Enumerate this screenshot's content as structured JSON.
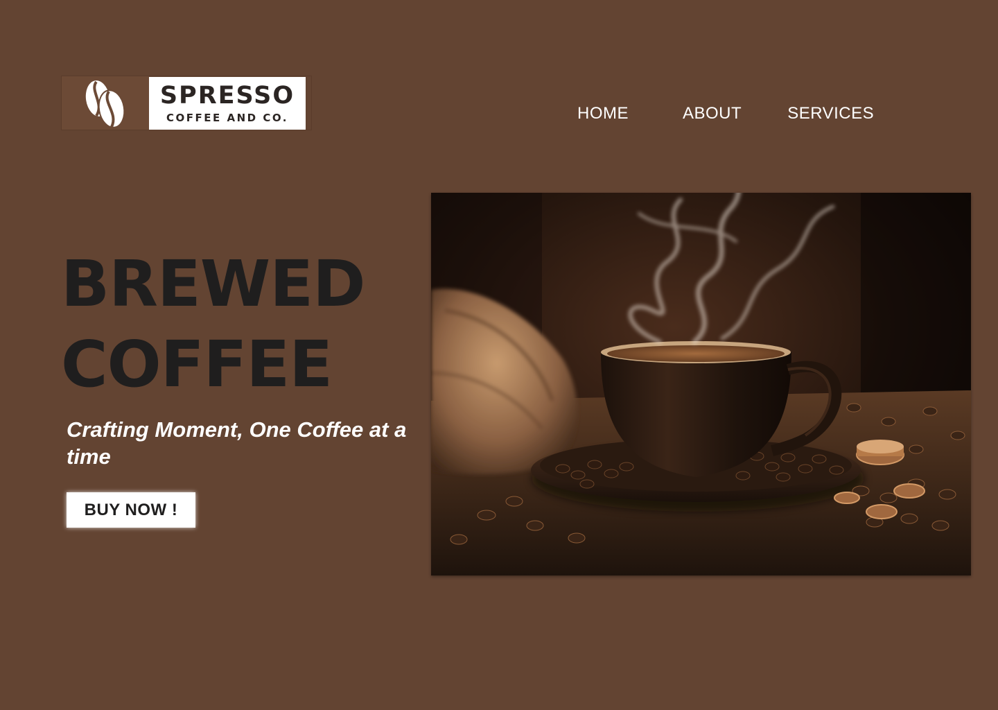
{
  "brand": {
    "name": "SPRESSO",
    "tagline": "COFFEE AND CO.",
    "icon": "coffee-bean-icon"
  },
  "nav": {
    "items": [
      {
        "label": "HOME"
      },
      {
        "label": "ABOUT"
      },
      {
        "label": "SERVICES"
      }
    ]
  },
  "hero": {
    "headline_line1": "BREWED",
    "headline_line2": "COFFEE",
    "subtitle": "Crafting Moment, One Coffee at a time",
    "cta_label": "BUY NOW !",
    "image": "steaming-coffee-cup-photo"
  },
  "colors": {
    "background": "#634432",
    "headline": "#1f1e1e",
    "text_light": "#ffffff"
  }
}
